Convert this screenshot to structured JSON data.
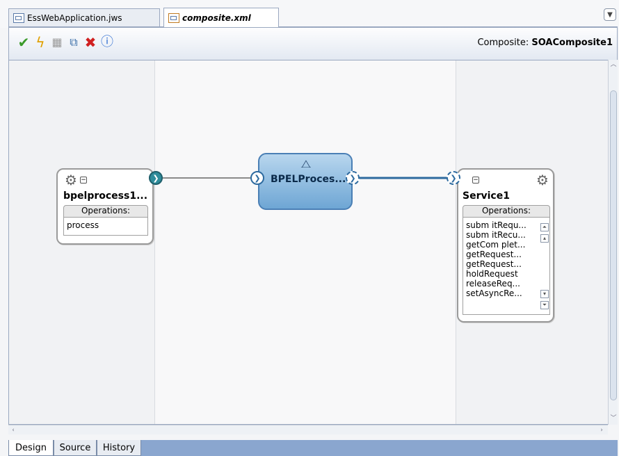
{
  "tabs": [
    {
      "label": "EssWebApplication.jws",
      "active": false
    },
    {
      "label": "composite.xml",
      "active": true
    }
  ],
  "toolbar": {
    "icons": [
      "validate-check-icon",
      "test-lightning-icon",
      "copy-icon",
      "layout-icon",
      "delete-icon",
      "info-icon"
    ],
    "composite_label": "Composite:",
    "composite_name": "SOAComposite1"
  },
  "canvas": {
    "left_component": {
      "title": "bpelprocess1...",
      "operations_label": "Operations:",
      "operations": [
        "process"
      ]
    },
    "middle_component": {
      "title": "BPELProces..."
    },
    "right_component": {
      "title": "Service1",
      "operations_label": "Operations:",
      "operations": [
        "subm itRequ...",
        "subm itRecu...",
        "getCom plet...",
        "getRequest...",
        "getRequest...",
        "holdRequest",
        "releaseReq...",
        "setAsyncRe..."
      ]
    }
  },
  "bottom_tabs": [
    "Design",
    "Source",
    "History"
  ],
  "colors": {
    "wire": "#2d6a9f",
    "bpel_fill": "#8dbbe2",
    "bottom_bar": "#8aa6cf"
  }
}
